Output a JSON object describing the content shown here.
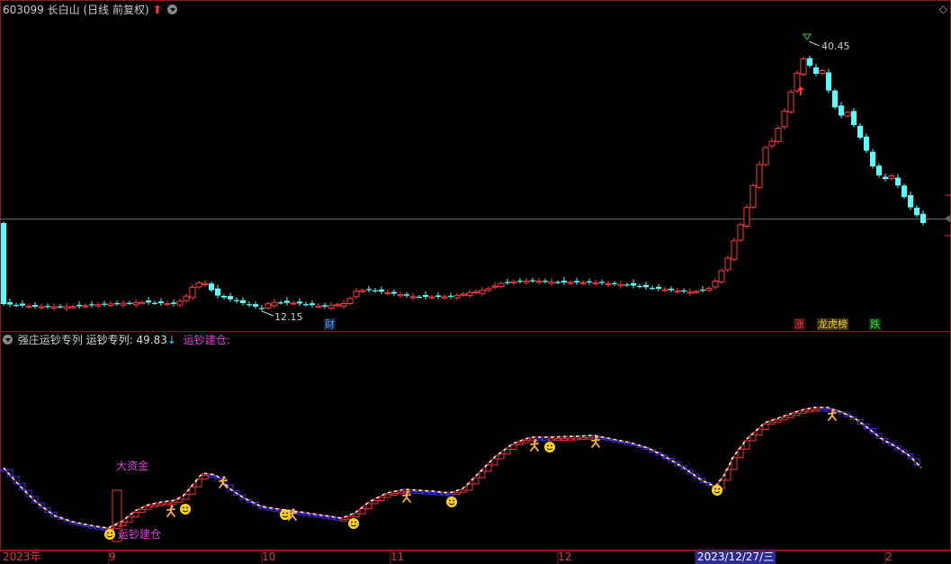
{
  "header": {
    "code": "603099",
    "name": "长白山",
    "period": "(日线 前复权)",
    "up_arrow": "up-arrow-icon"
  },
  "corner_icon": "diamond-icon",
  "main_chart": {
    "high_label": "40.45",
    "low_label": "12.15",
    "events": [
      {
        "text": "财",
        "color": "#4aa3ff"
      },
      {
        "text": "涨",
        "color": "#ff4040"
      },
      {
        "text": "龙虎榜",
        "display": "龙虎榜",
        "color": "#ffcc33"
      },
      {
        "text": "跌",
        "color": "#33dd33"
      }
    ],
    "up_color": "#ff3b3b",
    "down_color": "#54ffff"
  },
  "indicator": {
    "name": "强庄运钞专列",
    "series_label": "运钞专列:",
    "series_value": "49.83",
    "series_arrow": "↓",
    "signal_label": "运钞建仓:",
    "annotation_big": "大资金",
    "annotation_build": "运钞建仓"
  },
  "x_axis": {
    "labels": [
      "2023年",
      "9",
      "10",
      "11",
      "12",
      "2023/12/27/三",
      "2"
    ]
  },
  "chart_data": {
    "type": "candlestick",
    "title": "603099 长白山 (日线 前复权)",
    "price_high": 40.45,
    "price_low": 12.15,
    "x_ticks": [
      "2023年",
      "9",
      "10",
      "11",
      "12",
      "2023/12/27/三",
      "2"
    ],
    "indicator": {
      "name": "运钞专列",
      "last_value": 49.83
    }
  }
}
